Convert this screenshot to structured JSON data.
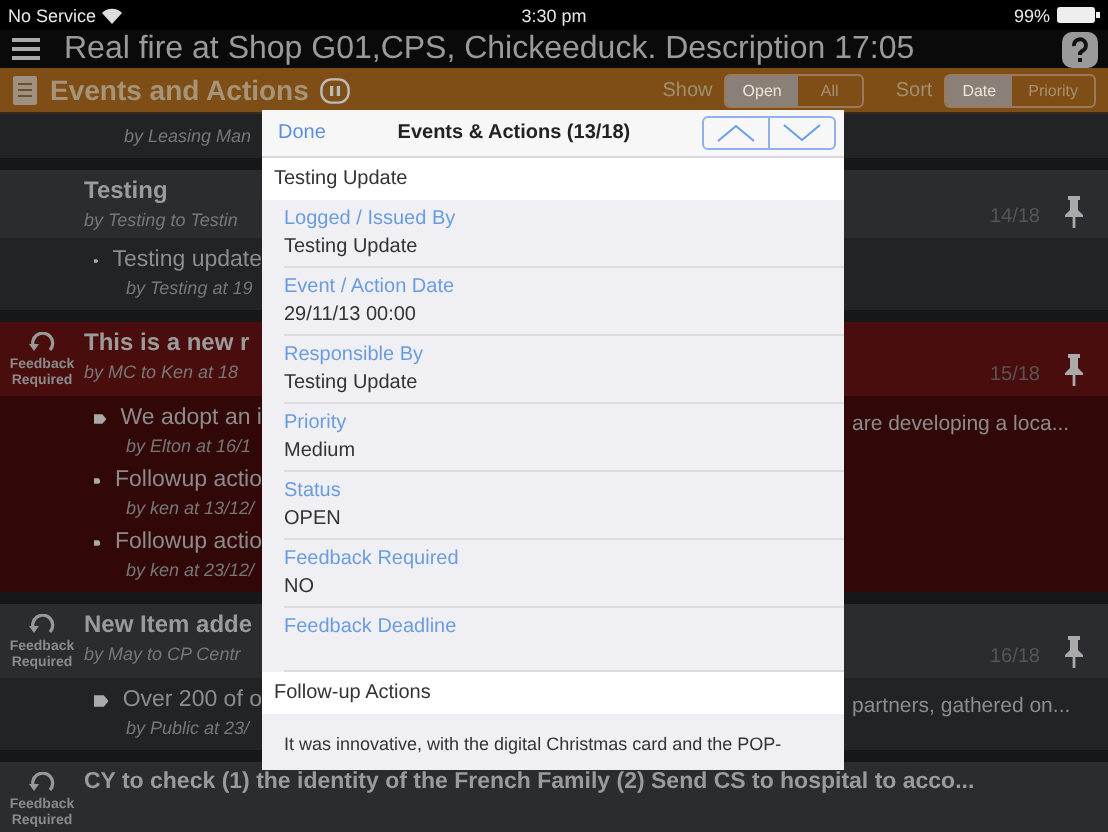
{
  "status_bar": {
    "carrier": "No Service",
    "time": "3:30 pm",
    "battery": "99%"
  },
  "nav": {
    "title": "Real fire at Shop G01,CPS, Chickeeduck. Description 17:05"
  },
  "toolbar": {
    "title": "Events and Actions",
    "show_label": "Show",
    "show_options": [
      {
        "label": "Open",
        "selected": true
      },
      {
        "label": "All",
        "selected": false
      }
    ],
    "sort_label": "Sort",
    "sort_options": [
      {
        "label": "Date",
        "selected": true
      },
      {
        "label": "Priority",
        "selected": false
      }
    ]
  },
  "partial_byline": "by Leasing Man",
  "events": [
    {
      "title": "Testing",
      "byline": "by Testing to Testin",
      "index": "14/18",
      "feedback_required": false,
      "highlighted": false,
      "followups": [
        {
          "text": "Testing update",
          "byline": "by Testing at 19"
        }
      ]
    },
    {
      "title": "This is a new r",
      "byline": "by MC to Ken at 18",
      "index": "15/18",
      "feedback_required": true,
      "badge": "Feedback Required",
      "highlighted": true,
      "followups": [
        {
          "text": "We adopt an i",
          "text_right": "are developing a loca...",
          "byline": "by Elton at 16/1"
        },
        {
          "text": "Followup actio",
          "byline": "by ken at 13/12/"
        },
        {
          "text": "Followup actio",
          "byline": "by ken at 23/12/"
        }
      ]
    },
    {
      "title": "New Item adde",
      "byline": "by May to CP Centr",
      "index": "16/18",
      "feedback_required": true,
      "badge": "Feedback Required",
      "highlighted": false,
      "followups": [
        {
          "text": "Over 200 of o",
          "text_right": "partners, gathered on...",
          "byline": "by Public at 23/"
        }
      ]
    },
    {
      "title": "CY to check (1) the identity of the French Family (2) Send CS to hospital to acco...",
      "feedback_required": true,
      "badge": "Feedback Required",
      "highlighted": false
    }
  ],
  "modal": {
    "done": "Done",
    "title": "Events & Actions (13/18)",
    "heading": "Testing Update",
    "fields": [
      {
        "label": "Logged / Issued By",
        "value": "Testing Update"
      },
      {
        "label": "Event / Action Date",
        "value": "29/11/13 00:00"
      },
      {
        "label": "Responsible By",
        "value": "Testing Update"
      },
      {
        "label": "Priority",
        "value": "Medium"
      },
      {
        "label": "Status",
        "value": "OPEN"
      },
      {
        "label": "Feedback Required",
        "value": "NO"
      },
      {
        "label": "Feedback Deadline"
      }
    ],
    "followup_heading": "Follow-up Actions",
    "followup_text": "It was innovative, with the digital Christmas card and the POP-"
  }
}
